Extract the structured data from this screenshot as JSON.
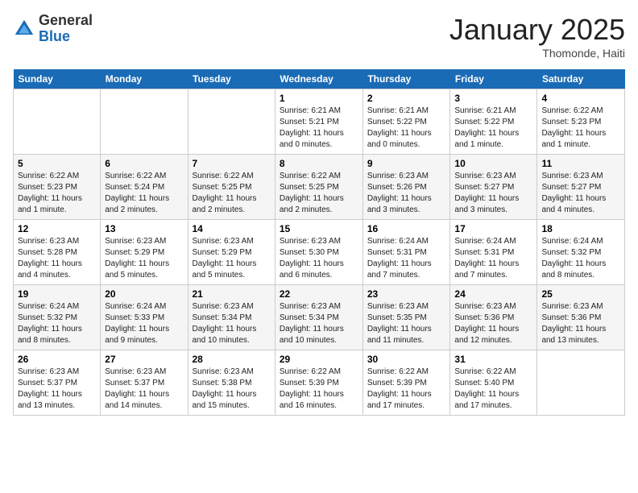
{
  "header": {
    "logo_general": "General",
    "logo_blue": "Blue",
    "month_title": "January 2025",
    "location": "Thomonde, Haiti"
  },
  "days_of_week": [
    "Sunday",
    "Monday",
    "Tuesday",
    "Wednesday",
    "Thursday",
    "Friday",
    "Saturday"
  ],
  "weeks": [
    [
      {
        "day": "",
        "info": ""
      },
      {
        "day": "",
        "info": ""
      },
      {
        "day": "",
        "info": ""
      },
      {
        "day": "1",
        "info": "Sunrise: 6:21 AM\nSunset: 5:21 PM\nDaylight: 11 hours and 0 minutes."
      },
      {
        "day": "2",
        "info": "Sunrise: 6:21 AM\nSunset: 5:22 PM\nDaylight: 11 hours and 0 minutes."
      },
      {
        "day": "3",
        "info": "Sunrise: 6:21 AM\nSunset: 5:22 PM\nDaylight: 11 hours and 1 minute."
      },
      {
        "day": "4",
        "info": "Sunrise: 6:22 AM\nSunset: 5:23 PM\nDaylight: 11 hours and 1 minute."
      }
    ],
    [
      {
        "day": "5",
        "info": "Sunrise: 6:22 AM\nSunset: 5:23 PM\nDaylight: 11 hours and 1 minute."
      },
      {
        "day": "6",
        "info": "Sunrise: 6:22 AM\nSunset: 5:24 PM\nDaylight: 11 hours and 2 minutes."
      },
      {
        "day": "7",
        "info": "Sunrise: 6:22 AM\nSunset: 5:25 PM\nDaylight: 11 hours and 2 minutes."
      },
      {
        "day": "8",
        "info": "Sunrise: 6:22 AM\nSunset: 5:25 PM\nDaylight: 11 hours and 2 minutes."
      },
      {
        "day": "9",
        "info": "Sunrise: 6:23 AM\nSunset: 5:26 PM\nDaylight: 11 hours and 3 minutes."
      },
      {
        "day": "10",
        "info": "Sunrise: 6:23 AM\nSunset: 5:27 PM\nDaylight: 11 hours and 3 minutes."
      },
      {
        "day": "11",
        "info": "Sunrise: 6:23 AM\nSunset: 5:27 PM\nDaylight: 11 hours and 4 minutes."
      }
    ],
    [
      {
        "day": "12",
        "info": "Sunrise: 6:23 AM\nSunset: 5:28 PM\nDaylight: 11 hours and 4 minutes."
      },
      {
        "day": "13",
        "info": "Sunrise: 6:23 AM\nSunset: 5:29 PM\nDaylight: 11 hours and 5 minutes."
      },
      {
        "day": "14",
        "info": "Sunrise: 6:23 AM\nSunset: 5:29 PM\nDaylight: 11 hours and 5 minutes."
      },
      {
        "day": "15",
        "info": "Sunrise: 6:23 AM\nSunset: 5:30 PM\nDaylight: 11 hours and 6 minutes."
      },
      {
        "day": "16",
        "info": "Sunrise: 6:24 AM\nSunset: 5:31 PM\nDaylight: 11 hours and 7 minutes."
      },
      {
        "day": "17",
        "info": "Sunrise: 6:24 AM\nSunset: 5:31 PM\nDaylight: 11 hours and 7 minutes."
      },
      {
        "day": "18",
        "info": "Sunrise: 6:24 AM\nSunset: 5:32 PM\nDaylight: 11 hours and 8 minutes."
      }
    ],
    [
      {
        "day": "19",
        "info": "Sunrise: 6:24 AM\nSunset: 5:32 PM\nDaylight: 11 hours and 8 minutes."
      },
      {
        "day": "20",
        "info": "Sunrise: 6:24 AM\nSunset: 5:33 PM\nDaylight: 11 hours and 9 minutes."
      },
      {
        "day": "21",
        "info": "Sunrise: 6:23 AM\nSunset: 5:34 PM\nDaylight: 11 hours and 10 minutes."
      },
      {
        "day": "22",
        "info": "Sunrise: 6:23 AM\nSunset: 5:34 PM\nDaylight: 11 hours and 10 minutes."
      },
      {
        "day": "23",
        "info": "Sunrise: 6:23 AM\nSunset: 5:35 PM\nDaylight: 11 hours and 11 minutes."
      },
      {
        "day": "24",
        "info": "Sunrise: 6:23 AM\nSunset: 5:36 PM\nDaylight: 11 hours and 12 minutes."
      },
      {
        "day": "25",
        "info": "Sunrise: 6:23 AM\nSunset: 5:36 PM\nDaylight: 11 hours and 13 minutes."
      }
    ],
    [
      {
        "day": "26",
        "info": "Sunrise: 6:23 AM\nSunset: 5:37 PM\nDaylight: 11 hours and 13 minutes."
      },
      {
        "day": "27",
        "info": "Sunrise: 6:23 AM\nSunset: 5:37 PM\nDaylight: 11 hours and 14 minutes."
      },
      {
        "day": "28",
        "info": "Sunrise: 6:23 AM\nSunset: 5:38 PM\nDaylight: 11 hours and 15 minutes."
      },
      {
        "day": "29",
        "info": "Sunrise: 6:22 AM\nSunset: 5:39 PM\nDaylight: 11 hours and 16 minutes."
      },
      {
        "day": "30",
        "info": "Sunrise: 6:22 AM\nSunset: 5:39 PM\nDaylight: 11 hours and 17 minutes."
      },
      {
        "day": "31",
        "info": "Sunrise: 6:22 AM\nSunset: 5:40 PM\nDaylight: 11 hours and 17 minutes."
      },
      {
        "day": "",
        "info": ""
      }
    ]
  ]
}
